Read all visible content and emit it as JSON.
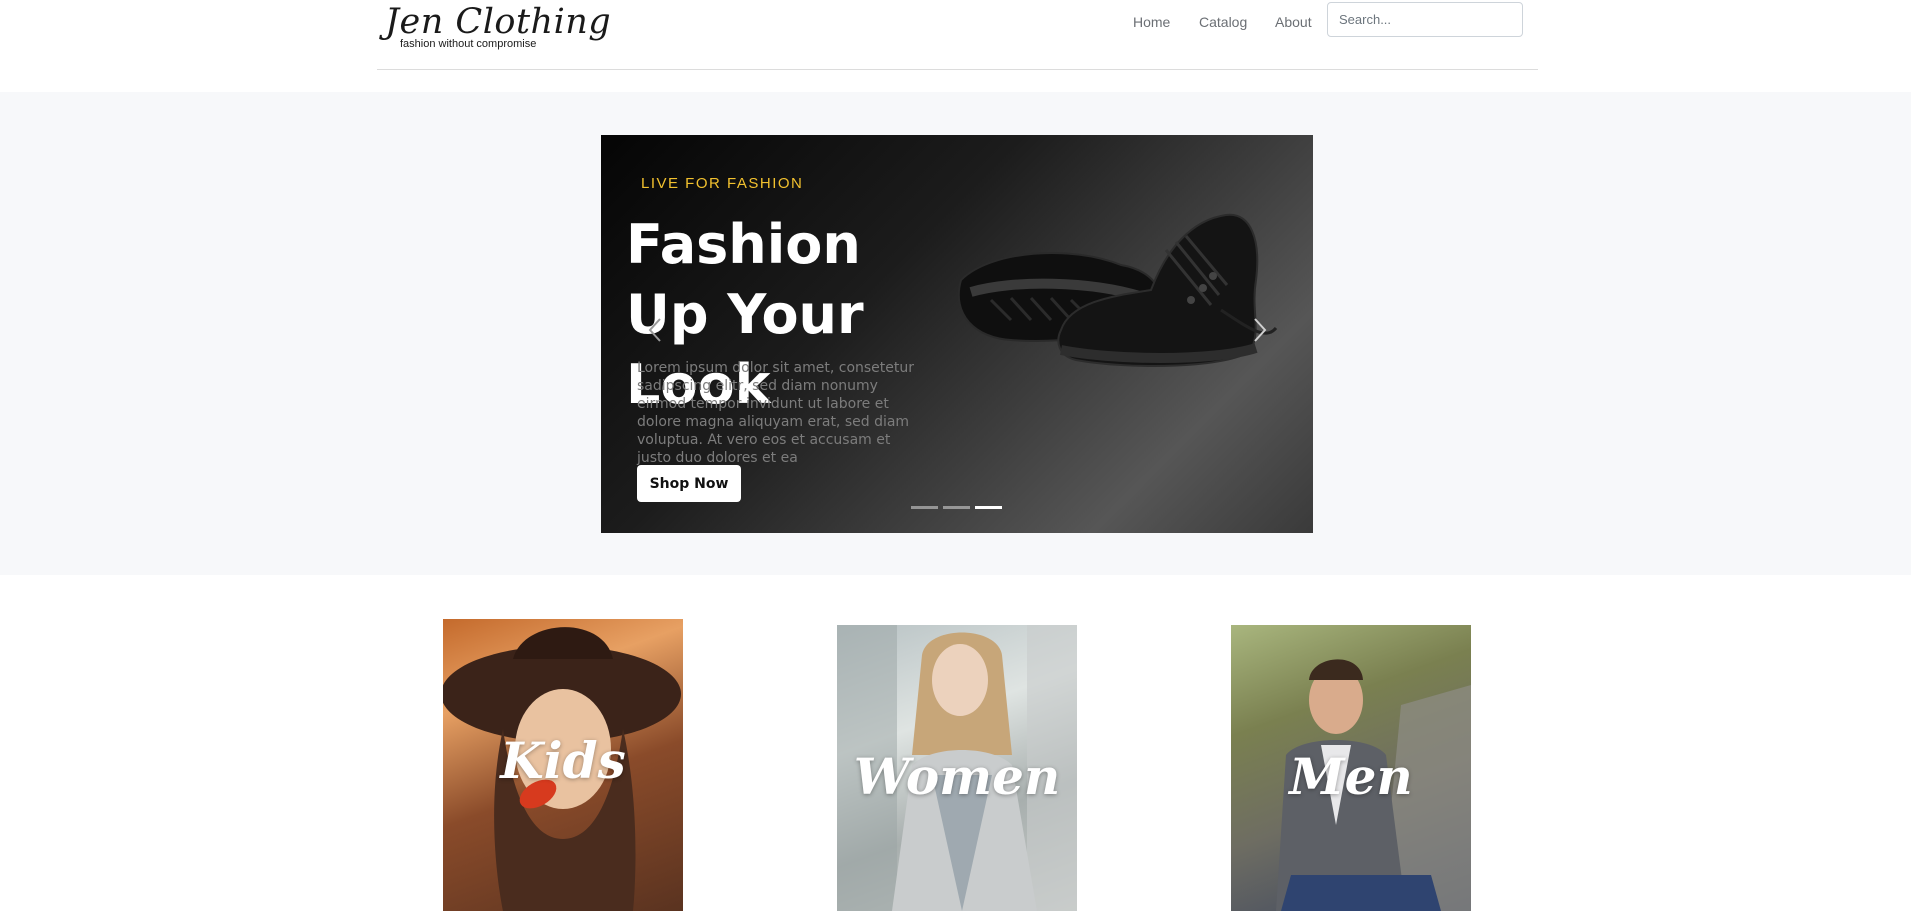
{
  "header": {
    "logo_script": "Jen Clothing",
    "logo_tagline": "fashion without compromise",
    "nav": [
      {
        "label": "Home"
      },
      {
        "label": "Catalog"
      },
      {
        "label": "About"
      }
    ],
    "search": {
      "placeholder": "Search...",
      "value": ""
    }
  },
  "hero": {
    "eyebrow": "LIVE FOR FASHION",
    "headline": "Fashion Up Your Look",
    "body": "Lorem ipsum dolor sit amet, consetetur sadipscing elitr, sed diam nonumy eirmod tempor invidunt ut labore et dolore magna aliquyam erat, sed diam voluptua. At vero eos et accusam et justo duo dolores et ea",
    "button_label": "Shop Now",
    "active_slide": 3,
    "slide_count": 3,
    "accent_color": "#f2c12e"
  },
  "categories": [
    {
      "label": "Kids"
    },
    {
      "label": "Women"
    },
    {
      "label": "Men"
    }
  ],
  "icons": {
    "prev": "chevron-left-icon",
    "next": "chevron-right-icon",
    "product": "sneaker-icon"
  }
}
